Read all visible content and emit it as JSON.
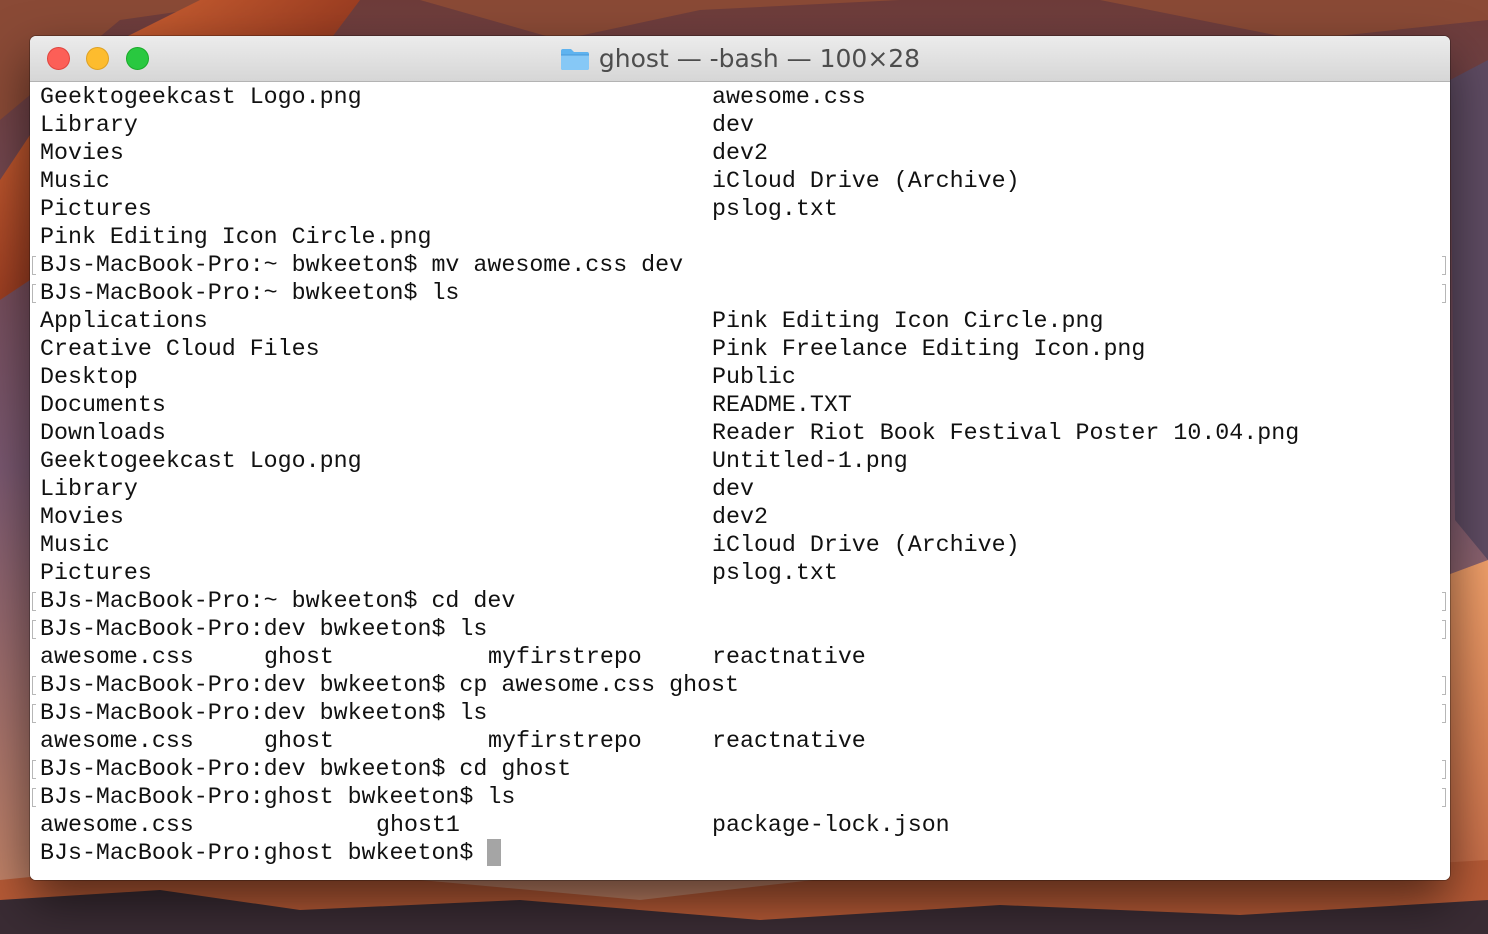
{
  "window": {
    "title": "ghost — -bash — 100×28",
    "folder_icon": "folder-icon",
    "traffic_lights": {
      "close": "#fc5f57",
      "minimize": "#fdbc2e",
      "zoom": "#29c840"
    }
  },
  "terminal": {
    "prompt_cursor_color": "#a5a5a5",
    "lines": [
      {
        "kind": "output",
        "cols": [
          "Geektogeekcast Logo.png",
          "",
          "",
          "awesome.css"
        ]
      },
      {
        "kind": "output",
        "cols": [
          "Library",
          "",
          "",
          "dev"
        ]
      },
      {
        "kind": "output",
        "cols": [
          "Movies",
          "",
          "",
          "dev2"
        ]
      },
      {
        "kind": "output",
        "cols": [
          "Music",
          "",
          "",
          "iCloud Drive (Archive)"
        ]
      },
      {
        "kind": "output",
        "cols": [
          "Pictures",
          "",
          "",
          "pslog.txt"
        ]
      },
      {
        "kind": "output",
        "cols": [
          "Pink Editing Icon Circle.png",
          "",
          "",
          ""
        ]
      },
      {
        "kind": "command",
        "text": "BJs-MacBook-Pro:~ bwkeeton$ mv awesome.css dev"
      },
      {
        "kind": "command",
        "text": "BJs-MacBook-Pro:~ bwkeeton$ ls"
      },
      {
        "kind": "output",
        "cols": [
          "Applications",
          "",
          "",
          "Pink Editing Icon Circle.png"
        ]
      },
      {
        "kind": "output",
        "cols": [
          "Creative Cloud Files",
          "",
          "",
          "Pink Freelance Editing Icon.png"
        ]
      },
      {
        "kind": "output",
        "cols": [
          "Desktop",
          "",
          "",
          "Public"
        ]
      },
      {
        "kind": "output",
        "cols": [
          "Documents",
          "",
          "",
          "README.TXT"
        ]
      },
      {
        "kind": "output",
        "cols": [
          "Downloads",
          "",
          "",
          "Reader Riot Book Festival Poster 10.04.png"
        ]
      },
      {
        "kind": "output",
        "cols": [
          "Geektogeekcast Logo.png",
          "",
          "",
          "Untitled-1.png"
        ]
      },
      {
        "kind": "output",
        "cols": [
          "Library",
          "",
          "",
          "dev"
        ]
      },
      {
        "kind": "output",
        "cols": [
          "Movies",
          "",
          "",
          "dev2"
        ]
      },
      {
        "kind": "output",
        "cols": [
          "Music",
          "",
          "",
          "iCloud Drive (Archive)"
        ]
      },
      {
        "kind": "output",
        "cols": [
          "Pictures",
          "",
          "",
          "pslog.txt"
        ]
      },
      {
        "kind": "command",
        "text": "BJs-MacBook-Pro:~ bwkeeton$ cd dev"
      },
      {
        "kind": "command",
        "text": "BJs-MacBook-Pro:dev bwkeeton$ ls"
      },
      {
        "kind": "output",
        "cols": [
          "awesome.css",
          "ghost",
          "myfirstrepo",
          "reactnative"
        ]
      },
      {
        "kind": "command",
        "text": "BJs-MacBook-Pro:dev bwkeeton$ cp awesome.css ghost"
      },
      {
        "kind": "command",
        "text": "BJs-MacBook-Pro:dev bwkeeton$ ls"
      },
      {
        "kind": "output",
        "cols": [
          "awesome.css",
          "ghost",
          "myfirstrepo",
          "reactnative"
        ]
      },
      {
        "kind": "command",
        "text": "BJs-MacBook-Pro:dev bwkeeton$ cd ghost"
      },
      {
        "kind": "command",
        "text": "BJs-MacBook-Pro:ghost bwkeeton$ ls"
      },
      {
        "kind": "output3",
        "cols": [
          "awesome.css",
          "ghost1",
          "package-lock.json"
        ]
      },
      {
        "kind": "prompt",
        "text": "BJs-MacBook-Pro:ghost bwkeeton$ "
      }
    ]
  }
}
